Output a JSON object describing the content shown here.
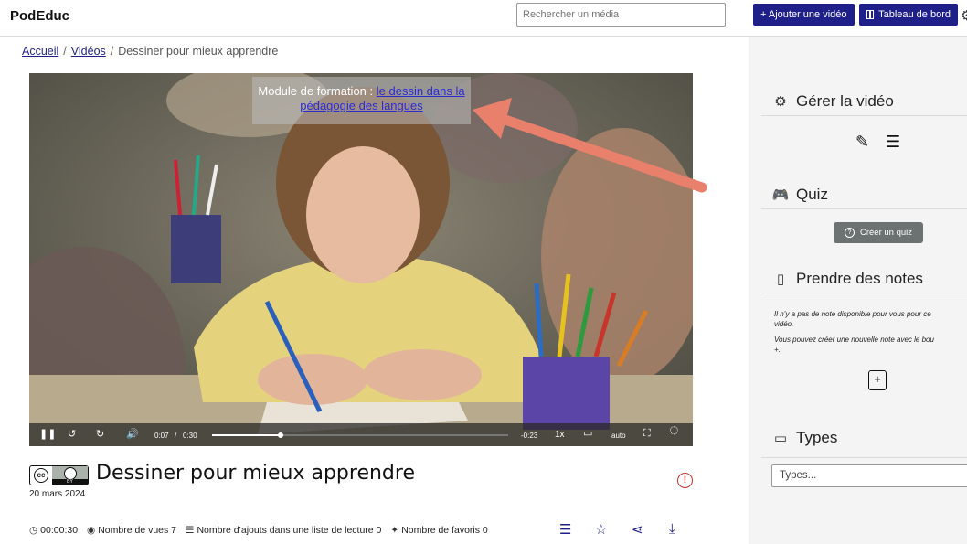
{
  "header": {
    "brand": "PodEduc",
    "search_placeholder": "Rechercher un média",
    "add_video": "+ Ajouter une vidéo",
    "dashboard": "Tableau de bord"
  },
  "breadcrumb": {
    "home": "Accueil",
    "videos": "Vidéos",
    "current": "Dessiner pour mieux apprendre",
    "separator": "/"
  },
  "video": {
    "overlay_prefix": "Module de formation : ",
    "overlay_link": "le dessin dans la pédagogie des langues",
    "current_time": "0:07",
    "time_separator": "/",
    "duration": "0:30",
    "remaining": "-0:23",
    "speed": "1x",
    "quality": "auto",
    "progress": 0.233
  },
  "meta": {
    "title": "Dessiner pour mieux apprendre",
    "date": "20 mars 2024",
    "license_cc": "cc",
    "duration": "00:00:30",
    "views": "Nombre de vues 7",
    "playlist_adds": "Nombre d’ajouts dans une liste de lecture 0",
    "favorites": "Nombre de favoris 0"
  },
  "sidebar": {
    "manage_title": "Gérer la vidéo",
    "quiz_title": "Quiz",
    "create_quiz": "Créer un quiz",
    "notes_title": "Prendre des notes",
    "notes_line1": "Il n’y a pas de note disponible pour vous pour ce",
    "notes_line2": "vidéo.",
    "notes_line3": "Vous pouvez créer une nouvelle note avec le bou",
    "notes_line4": "+.",
    "types_title": "Types",
    "types_placeholder": "Types..."
  },
  "colors": {
    "primary": "#1f1f8a",
    "sidebar_bg": "#f4f4f4",
    "arrow": "#e8806b",
    "report": "#c83232",
    "quiz_button": "#6c7272"
  },
  "icons": [
    "film-icon",
    "gear-icon",
    "play-pause-icon",
    "rewind-icon",
    "forward-icon",
    "volume-icon",
    "subtitles-icon",
    "fullscreen-icon",
    "report-icon",
    "list-icon",
    "star-icon",
    "share-icon",
    "download-icon",
    "edit-icon",
    "menu-icon",
    "gamepad-icon",
    "notebook-icon",
    "add-note-icon",
    "monitor-icon",
    "clock-icon",
    "eye-icon"
  ]
}
